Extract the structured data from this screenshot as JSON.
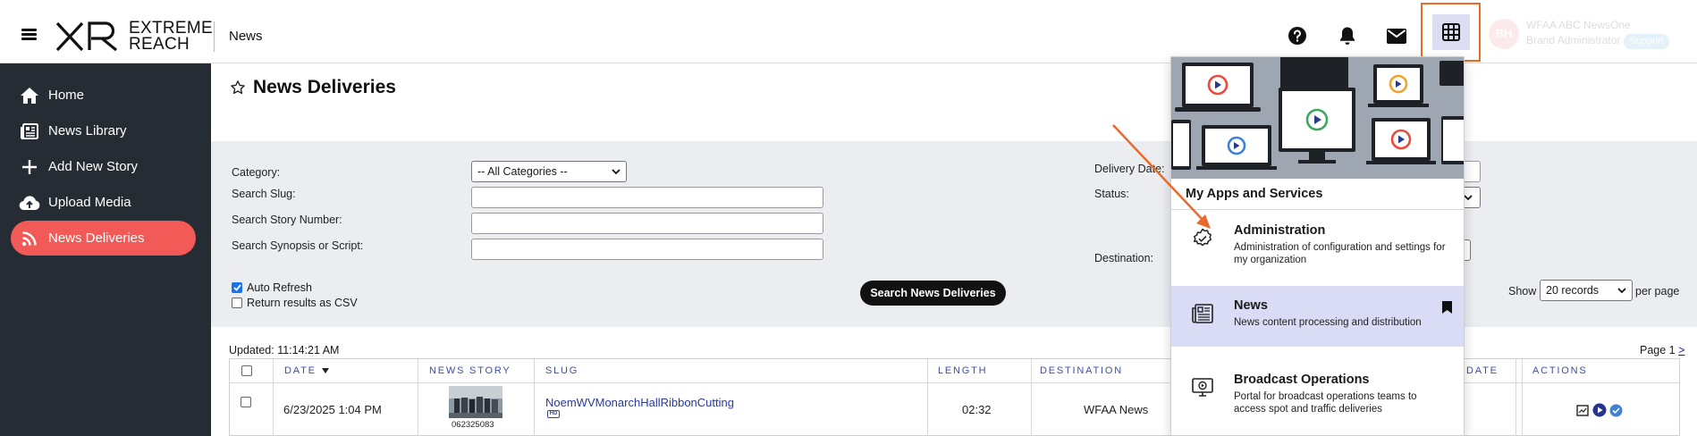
{
  "topbar": {
    "logo_line1": "EXTREME",
    "logo_line2": "REACH",
    "logo_mark": "XR",
    "breadcrumb": "News",
    "icons": [
      "help-icon",
      "bell-icon",
      "mail-icon",
      "apps-grid-icon"
    ],
    "user": {
      "initials": "BH",
      "name": "WFAA ABC NewsOne",
      "role": "Brand Administrator",
      "badge": "Support"
    }
  },
  "sidebar": {
    "items": [
      {
        "label": "Home",
        "icon": "home-icon"
      },
      {
        "label": "News Library",
        "icon": "newspaper-icon"
      },
      {
        "label": "Add New Story",
        "icon": "plus-icon"
      },
      {
        "label": "Upload Media",
        "icon": "cloud-upload-icon"
      },
      {
        "label": "News Deliveries",
        "icon": "rss-icon",
        "active": true
      }
    ]
  },
  "page": {
    "title": "News Deliveries"
  },
  "filters": {
    "category_label": "Category:",
    "category_value": "-- All Categories --",
    "slug_label": "Search Slug:",
    "story_number_label": "Search Story Number:",
    "synopsis_label": "Search Synopsis or Script:",
    "delivery_date_label": "Delivery Date:",
    "status_label": "Status:",
    "destination_label": "Destination:",
    "auto_refresh_label": "Auto Refresh",
    "csv_label": "Return results as CSV",
    "search_button": "Search News Deliveries",
    "show_label": "Show",
    "records_value": "20 records",
    "per_page_label": "per page"
  },
  "results": {
    "updated": "Updated: 11:14:21 AM",
    "page_label": "Page 1",
    "next": ">",
    "columns": {
      "date": "DATE",
      "news_story": "NEWS STORY",
      "slug": "SLUG",
      "length": "LENGTH",
      "destination": "DESTINATION",
      "date2": "DATE",
      "actions": "ACTIONS"
    },
    "rows": [
      {
        "date": "6/23/2025 1:04 PM",
        "story_number": "062325083",
        "slug": "NoemWVMonarchHallRibbonCutting",
        "quality": "HD",
        "length": "02:32",
        "destination": "WFAA News"
      }
    ]
  },
  "apps_panel": {
    "title": "My Apps and Services",
    "apps": [
      {
        "name": "Administration",
        "desc": "Administration of configuration and settings for my organization",
        "icon": "gear-badge-icon"
      },
      {
        "name": "News",
        "desc": "News content processing and distribution",
        "icon": "newspaper-icon",
        "selected": true
      },
      {
        "name": "Broadcast Operations",
        "desc": "Portal for broadcast operations teams to access spot and traffic deliveries",
        "icon": "monitor-icon"
      }
    ]
  },
  "colors": {
    "accent_orange": "#ea6a2c",
    "active_nav": "#f25a57",
    "sidebar_bg": "#262c33",
    "selected_app": "#d9dcf4"
  }
}
